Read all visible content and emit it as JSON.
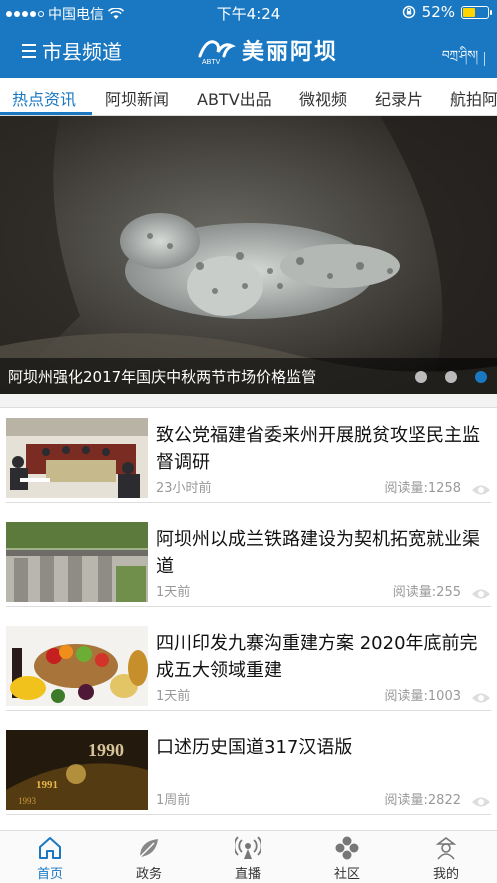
{
  "status": {
    "carrier": "中国电信",
    "time": "下午4:24",
    "battery": "52%",
    "battery_level": 0.52
  },
  "header": {
    "menu_label": "市县频道",
    "logo_text": "美丽阿坝",
    "logo_sub": "ABTV",
    "right_label": "བཀྲ་ཤིས།"
  },
  "tabs": [
    "热点资讯",
    "阿坝新闻",
    "ABTV出品",
    "微视频",
    "纪录片",
    "航拍阿"
  ],
  "banner": {
    "caption": "阿坝州强化2017年国庆中秋两节市场价格监管",
    "pages": 3,
    "active_page": 3
  },
  "news": [
    {
      "title": "致公党福建省委来州开展脱贫攻坚民主监督调研",
      "time": "23小时前",
      "reads": "阅读量:1258"
    },
    {
      "title": "阿坝州以成兰铁路建设为契机拓宽就业渠道",
      "time": "1天前",
      "reads": "阅读量:255"
    },
    {
      "title": "四川印发九寨沟重建方案 2020年底前完成五大领域重建",
      "time": "1天前",
      "reads": "阅读量:1003"
    },
    {
      "title": "口述历史国道317汉语版",
      "time": "1周前",
      "reads": "阅读量:2822"
    }
  ],
  "nav": [
    {
      "label": "首页",
      "icon": "home-icon"
    },
    {
      "label": "政务",
      "icon": "leaf-icon"
    },
    {
      "label": "直播",
      "icon": "broadcast-icon"
    },
    {
      "label": "社区",
      "icon": "community-icon"
    },
    {
      "label": "我的",
      "icon": "profile-icon"
    }
  ],
  "colors": {
    "brand": "#1a78c2",
    "battery": "#ffd400"
  }
}
